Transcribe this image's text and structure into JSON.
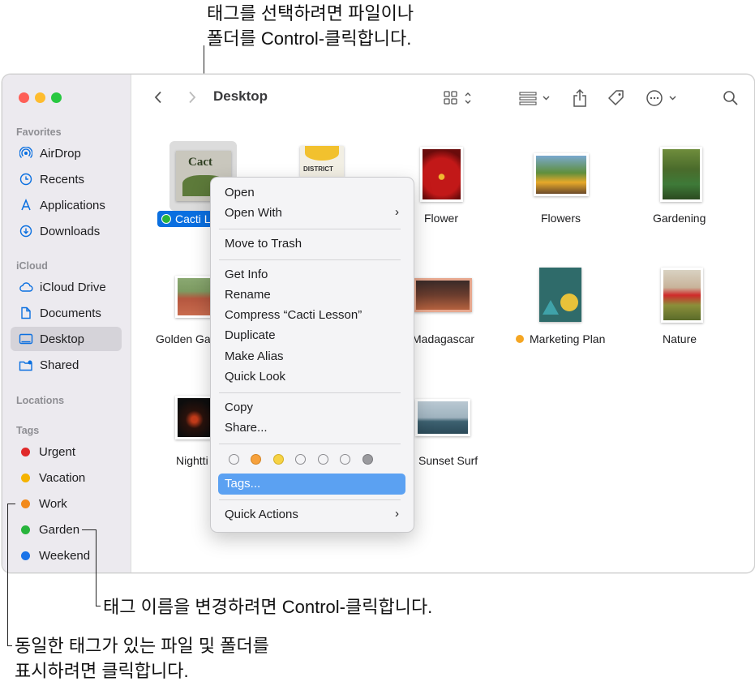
{
  "callouts": {
    "top": "태그를 선택하려면 파일이나\n폴더를 Control-클릭합니다.",
    "rename": "태그 이름을 변경하려면 Control-클릭합니다.",
    "show": "동일한 태그가 있는 파일 및 폴더를\n표시하려면 클릭합니다."
  },
  "window": {
    "title": "Desktop"
  },
  "sidebar": {
    "favorites_header": "Favorites",
    "icloud_header": "iCloud",
    "locations_header": "Locations",
    "tags_header": "Tags",
    "favorites": [
      "AirDrop",
      "Recents",
      "Applications",
      "Downloads"
    ],
    "icloud": [
      "iCloud Drive",
      "Documents",
      "Desktop",
      "Shared"
    ],
    "tags": [
      {
        "label": "Urgent",
        "color": "#e02a2a"
      },
      {
        "label": "Vacation",
        "color": "#f5b300"
      },
      {
        "label": "Work",
        "color": "#f28a1b"
      },
      {
        "label": "Garden",
        "color": "#28b43c"
      },
      {
        "label": "Weekend",
        "color": "#1a73e8"
      }
    ]
  },
  "files": {
    "cacti": "Cacti L",
    "flower": "Flower",
    "flowers": "Flowers",
    "gardening": "Gardening",
    "golden": "Golden Ga",
    "madagascar": "Madagascar",
    "marketing": "Marketing Plan",
    "nature": "Nature",
    "nightti": "Nightti",
    "sunset": "Sunset Surf"
  },
  "menu": {
    "open": "Open",
    "open_with": "Open With",
    "move_trash": "Move to Trash",
    "get_info": "Get Info",
    "rename": "Rename",
    "compress": "Compress “Cacti Lesson”",
    "duplicate": "Duplicate",
    "make_alias": "Make Alias",
    "quick_look": "Quick Look",
    "copy": "Copy",
    "share": "Share...",
    "tags": "Tags...",
    "quick_actions": "Quick Actions",
    "tag_colors": [
      "none",
      "#f6a13c",
      "#f6d244",
      "none",
      "none",
      "none",
      "#9a9a9e"
    ]
  },
  "thumb_text": {
    "cacti": "Cact",
    "district": "DISTRICT"
  },
  "colors": {
    "accent": "#1a73e8",
    "menu_highlight": "#5ba1f2",
    "marketing_tag": "#f5a623"
  }
}
